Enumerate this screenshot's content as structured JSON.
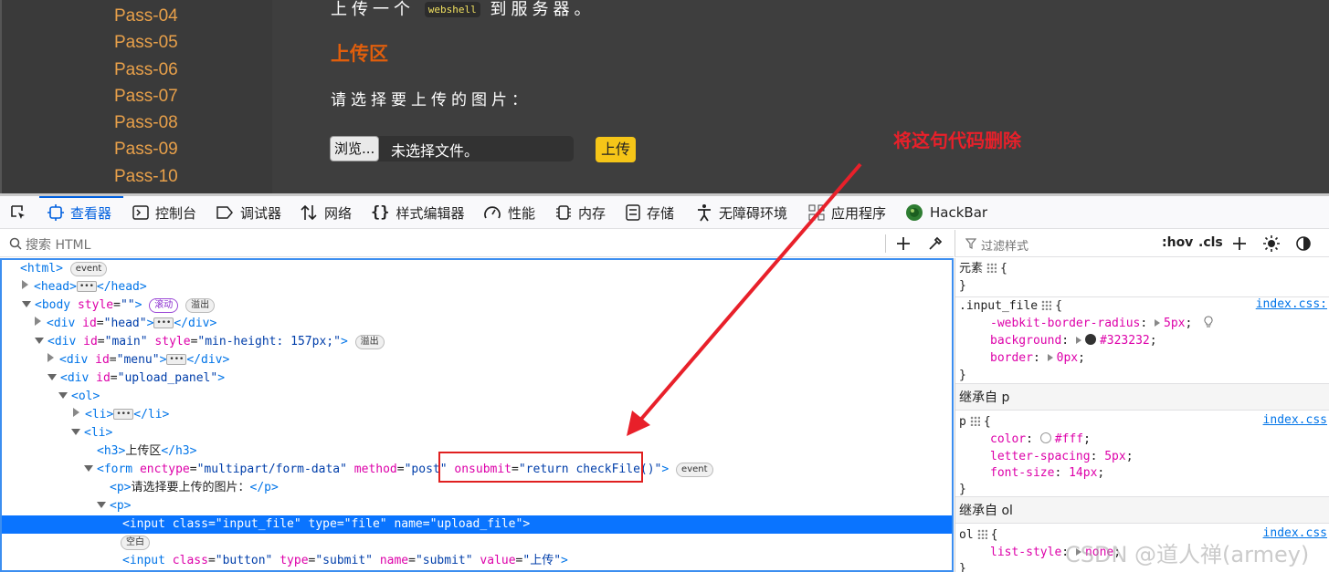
{
  "webpage": {
    "pass_items": [
      "Pass-04",
      "Pass-05",
      "Pass-06",
      "Pass-07",
      "Pass-08",
      "Pass-09",
      "Pass-10"
    ],
    "intro_prefix": "上传一个",
    "intro_code": "webshell",
    "intro_suffix": "到服务器。",
    "upload_heading": "上传区",
    "upload_prompt": "请选择要上传的图片：",
    "browse_label": "浏览...",
    "no_file_text": "未选择文件。",
    "upload_button": "上传"
  },
  "toolbar": {
    "tabs": [
      {
        "label": "查看器",
        "icon": "inspector-icon"
      },
      {
        "label": "控制台",
        "icon": "console-icon"
      },
      {
        "label": "调试器",
        "icon": "debugger-icon"
      },
      {
        "label": "网络",
        "icon": "network-icon"
      },
      {
        "label": "样式编辑器",
        "icon": "braces-icon"
      },
      {
        "label": "性能",
        "icon": "gauge-icon"
      },
      {
        "label": "内存",
        "icon": "memory-icon"
      },
      {
        "label": "存储",
        "icon": "storage-icon"
      },
      {
        "label": "无障碍环境",
        "icon": "accessibility-icon"
      },
      {
        "label": "应用程序",
        "icon": "grid-icon"
      },
      {
        "label": "HackBar",
        "icon": "hackbar-icon"
      }
    ],
    "active_color": "#0060df"
  },
  "search": {
    "placeholder": "搜索 HTML",
    "filter_placeholder": "过滤样式",
    "hov": ":hov",
    "cls": ".cls"
  },
  "markup": {
    "badge_event": "event",
    "badge_scroll": "滚动",
    "badge_overflow": "溢出",
    "badge_whitespace": "空白",
    "l_html": "<html>",
    "l_head_open": "<head>",
    "l_head_close": "</head>",
    "l_body_tag": "<body",
    "l_body_attr": "style",
    "l_body_val": "\"\"",
    "l_div": "<div",
    "l_div_close": "</div>",
    "l_id": "id",
    "l_head_val": "\"head\"",
    "l_main_val": "\"main\"",
    "l_style": "style",
    "l_main_style_val": "\"min-height: 157px;\"",
    "l_menu_val": "\"menu\"",
    "l_panel_val": "\"upload_panel\"",
    "l_ol": "<ol>",
    "l_li": "<li>",
    "l_li_close": "</li>",
    "l_h3": "<h3>",
    "l_h3_text": "上传区",
    "l_h3_close": "</h3>",
    "l_form": "<form",
    "l_enctype": "enctype",
    "l_enctype_val": "\"multipart/form-data\"",
    "l_method": "method",
    "l_method_val": "\"post\"",
    "l_onsubmit": "onsubmit",
    "l_onsubmit_val": "\"return checkFile()\"",
    "l_p": "<p>",
    "l_p_text": "请选择要上传的图片：",
    "l_p_close": "</p>",
    "l_input": "<input",
    "l_class": "class",
    "l_input_class_val": "\"input_file\"",
    "l_type": "type",
    "l_file_val": "\"file\"",
    "l_name": "name",
    "l_upload_file_val": "\"upload_file\"",
    "l_button_class_val": "\"button\"",
    "l_submit_val": "\"submit\"",
    "l_value": "value",
    "l_upload_val": "\"上传\""
  },
  "rules": {
    "element_label": "元素",
    "rule1_selector": ".input_file",
    "rule1_source": "index.css:",
    "rule1_props": [
      {
        "name": "-webkit-border-radius",
        "value": "5px"
      },
      {
        "name": "background",
        "value": "#323232",
        "swatch": "#323232"
      },
      {
        "name": "border",
        "value": "0px"
      }
    ],
    "inherit_p": "继承自 p",
    "rule2_selector": "p",
    "rule2_source": "index.css",
    "rule2_props": [
      {
        "name": "color",
        "value": "#fff",
        "swatch": "#ffffff"
      },
      {
        "name": "letter-spacing",
        "value": "5px"
      },
      {
        "name": "font-size",
        "value": "14px"
      }
    ],
    "inherit_ol": "继承自 ol",
    "rule3_selector": "ol",
    "rule3_source": "index.css",
    "rule3_props": [
      {
        "name": "list-style",
        "value": "none"
      }
    ]
  },
  "annotation": {
    "label": "将这句代码删除",
    "color": "#e8202a"
  },
  "watermark": "CSDN @道人禅(armey)"
}
